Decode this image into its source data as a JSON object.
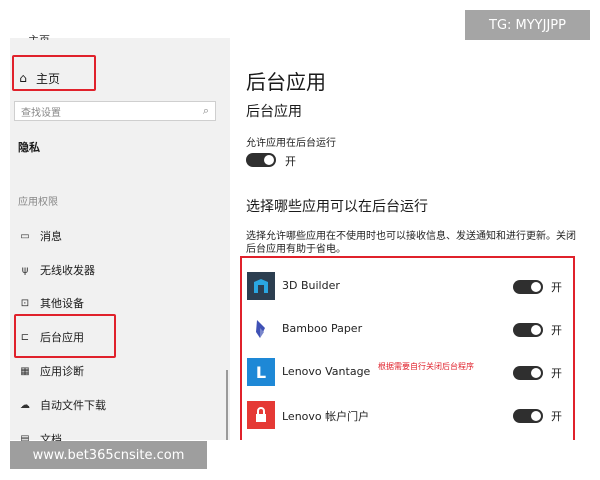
{
  "sidebar": {
    "top_fragment": "主页",
    "home_label": "主页",
    "search_placeholder": "查找设置",
    "privacy_heading": "隐私",
    "app_permissions_heading": "应用权限",
    "items": [
      {
        "icon": "message-icon",
        "label": "消息"
      },
      {
        "icon": "radio-icon",
        "label": "无线收发器"
      },
      {
        "icon": "devices-icon",
        "label": "其他设备"
      },
      {
        "icon": "background-apps-icon",
        "label": "后台应用"
      },
      {
        "icon": "app-diagnostics-icon",
        "label": "应用诊断"
      },
      {
        "icon": "cloud-icon",
        "label": "自动文件下载"
      },
      {
        "icon": "document-icon",
        "label": "文档"
      }
    ]
  },
  "main": {
    "title": "后台应用",
    "subtitle": "后台应用",
    "allow_label": "允许应用在后台运行",
    "allow_toggle_state": "开",
    "section_heading": "选择哪些应用可以在后台运行",
    "description": "选择允许哪些应用在不使用时也可以接收信息、发送通知和进行更新。关闭后台应用有助于省电。",
    "apps": [
      {
        "name": "3D Builder",
        "icon": "3d-builder-icon",
        "icon_color": "#2c3e50",
        "state": "开"
      },
      {
        "name": "Bamboo Paper",
        "icon": "bamboo-paper-icon",
        "icon_color": "#ffffff",
        "state": "开"
      },
      {
        "name": "Lenovo Vantage",
        "icon": "lenovo-vantage-icon",
        "icon_color": "#1e88d6",
        "state": "开"
      },
      {
        "name": "Lenovo 帐户门户",
        "icon": "lenovo-account-icon",
        "icon_color": "#e53935",
        "state": "开"
      }
    ],
    "annotation": "根据需要自行关闭后台程序"
  },
  "overlays": {
    "tg_badge": "TG: MYYJJPP",
    "url_badge": "www.bet365cnsite.com"
  },
  "colors": {
    "highlight": "#e0212b",
    "toggle_on": "#2f2f2f",
    "sidebar_bg": "#f1f1f1"
  }
}
